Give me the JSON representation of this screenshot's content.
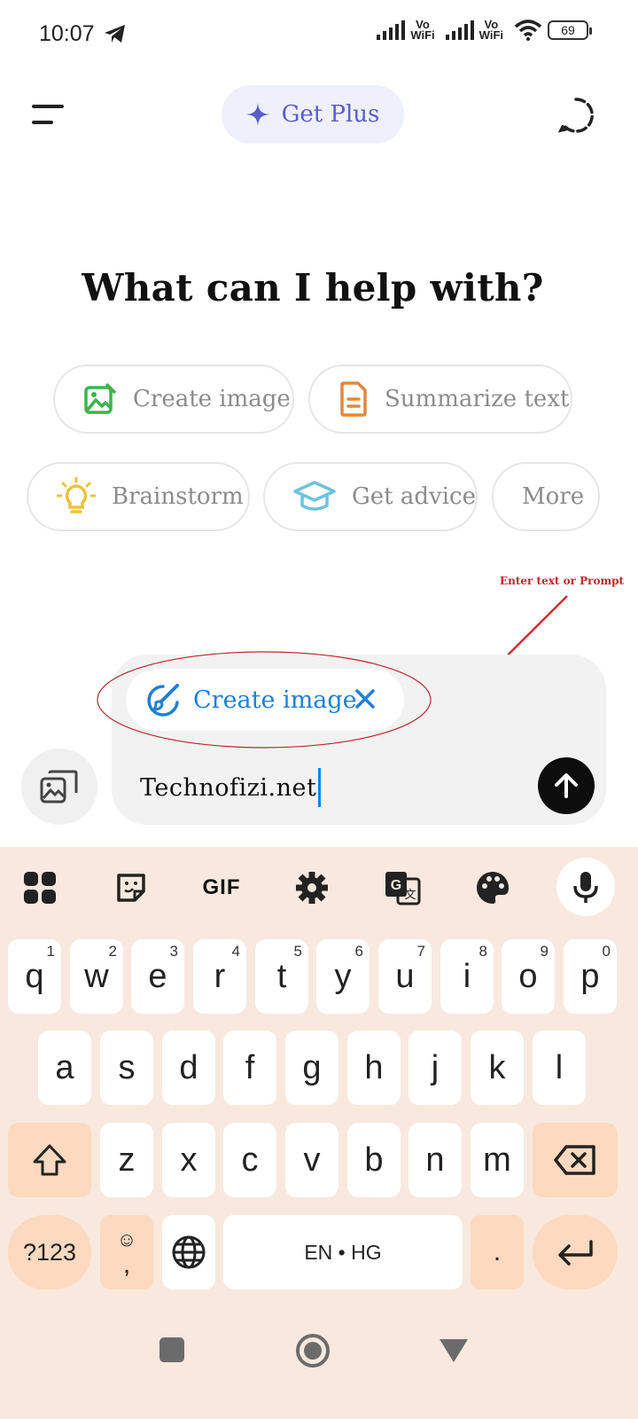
{
  "status_bar": {
    "time": "10:07",
    "battery": "69",
    "sim1_label_top": "Vo",
    "sim1_label_bottom": "WiFi",
    "sim2_label_top": "Vo",
    "sim2_label_bottom": "WiFi",
    "icons": [
      "telegram-icon",
      "signal-icon",
      "wifi-icon",
      "battery-icon"
    ]
  },
  "header": {
    "get_plus_label": "Get Plus",
    "icons": [
      "menu-icon",
      "sparkle-icon",
      "new-chat-icon"
    ]
  },
  "main": {
    "heading": "What can I help with?",
    "suggestions": [
      {
        "label": "Create image",
        "icon": "create-image-icon",
        "color": "#3bb54a"
      },
      {
        "label": "Summarize text",
        "icon": "document-icon",
        "color": "#e0883d"
      },
      {
        "label": "Brainstorm",
        "icon": "lightbulb-icon",
        "color": "#e9c43a"
      },
      {
        "label": "Get advice",
        "icon": "graduation-cap-icon",
        "color": "#6cc3e0"
      },
      {
        "label": "More",
        "icon": "",
        "color": ""
      }
    ]
  },
  "annotation": {
    "label": "Enter text or Prompt",
    "color": "#c0282d"
  },
  "composer": {
    "tool_chip_label": "Create image",
    "input_value": "Technofizi.net",
    "accent": "#1f7fd6",
    "icons": [
      "attach-photo-icon",
      "paintbrush-icon",
      "close-icon",
      "send-arrow-icon"
    ]
  },
  "keyboard": {
    "toolbar_items": [
      "apps-grid-icon",
      "sticker-icon",
      "GIF",
      "settings-icon",
      "translate-icon",
      "palette-icon",
      "mic-icon"
    ],
    "gif_label": "GIF",
    "row1": [
      {
        "key": "q",
        "alt": "1"
      },
      {
        "key": "w",
        "alt": "2"
      },
      {
        "key": "e",
        "alt": "3"
      },
      {
        "key": "r",
        "alt": "4"
      },
      {
        "key": "t",
        "alt": "5"
      },
      {
        "key": "y",
        "alt": "6"
      },
      {
        "key": "u",
        "alt": "7"
      },
      {
        "key": "i",
        "alt": "8"
      },
      {
        "key": "o",
        "alt": "9"
      },
      {
        "key": "p",
        "alt": "0"
      }
    ],
    "row2": [
      "a",
      "s",
      "d",
      "f",
      "g",
      "h",
      "j",
      "k",
      "l"
    ],
    "row3": [
      "z",
      "x",
      "c",
      "v",
      "b",
      "n",
      "m"
    ],
    "symbols_label": "?123",
    "comma_label": ",",
    "emoji_label": "☺",
    "space_label": "EN • HG",
    "period_label": ".",
    "background": "#f9e8dd",
    "special_key_color": "#fcd9bf"
  },
  "nav_bar": {
    "icons": [
      "recents-icon",
      "home-icon",
      "back-icon"
    ]
  }
}
